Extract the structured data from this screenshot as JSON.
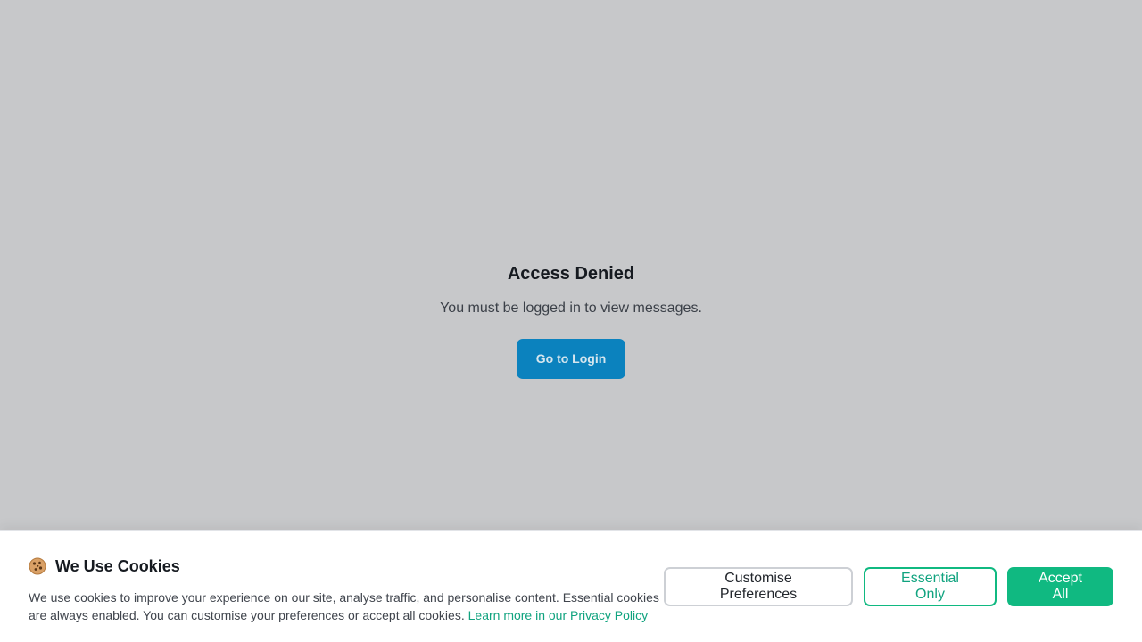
{
  "page": {
    "title": "Access Denied",
    "message": "You must be logged in to view messages.",
    "login_button": "Go to Login"
  },
  "cookie_banner": {
    "icon": "cookie-icon",
    "title": "We Use Cookies",
    "description": "We use cookies to improve your experience on our site, analyse traffic, and personalise content. Essential cookies are always enabled. You can customise your preferences or accept all cookies.",
    "privacy_link": "Learn more in our Privacy Policy",
    "buttons": {
      "customise": "Customise Preferences",
      "essential": "Essential Only",
      "accept": "Accept All"
    }
  },
  "colors": {
    "accent": "#10b981",
    "primary_button": "#0b82be",
    "overlay_background": "#c7c8ca"
  }
}
